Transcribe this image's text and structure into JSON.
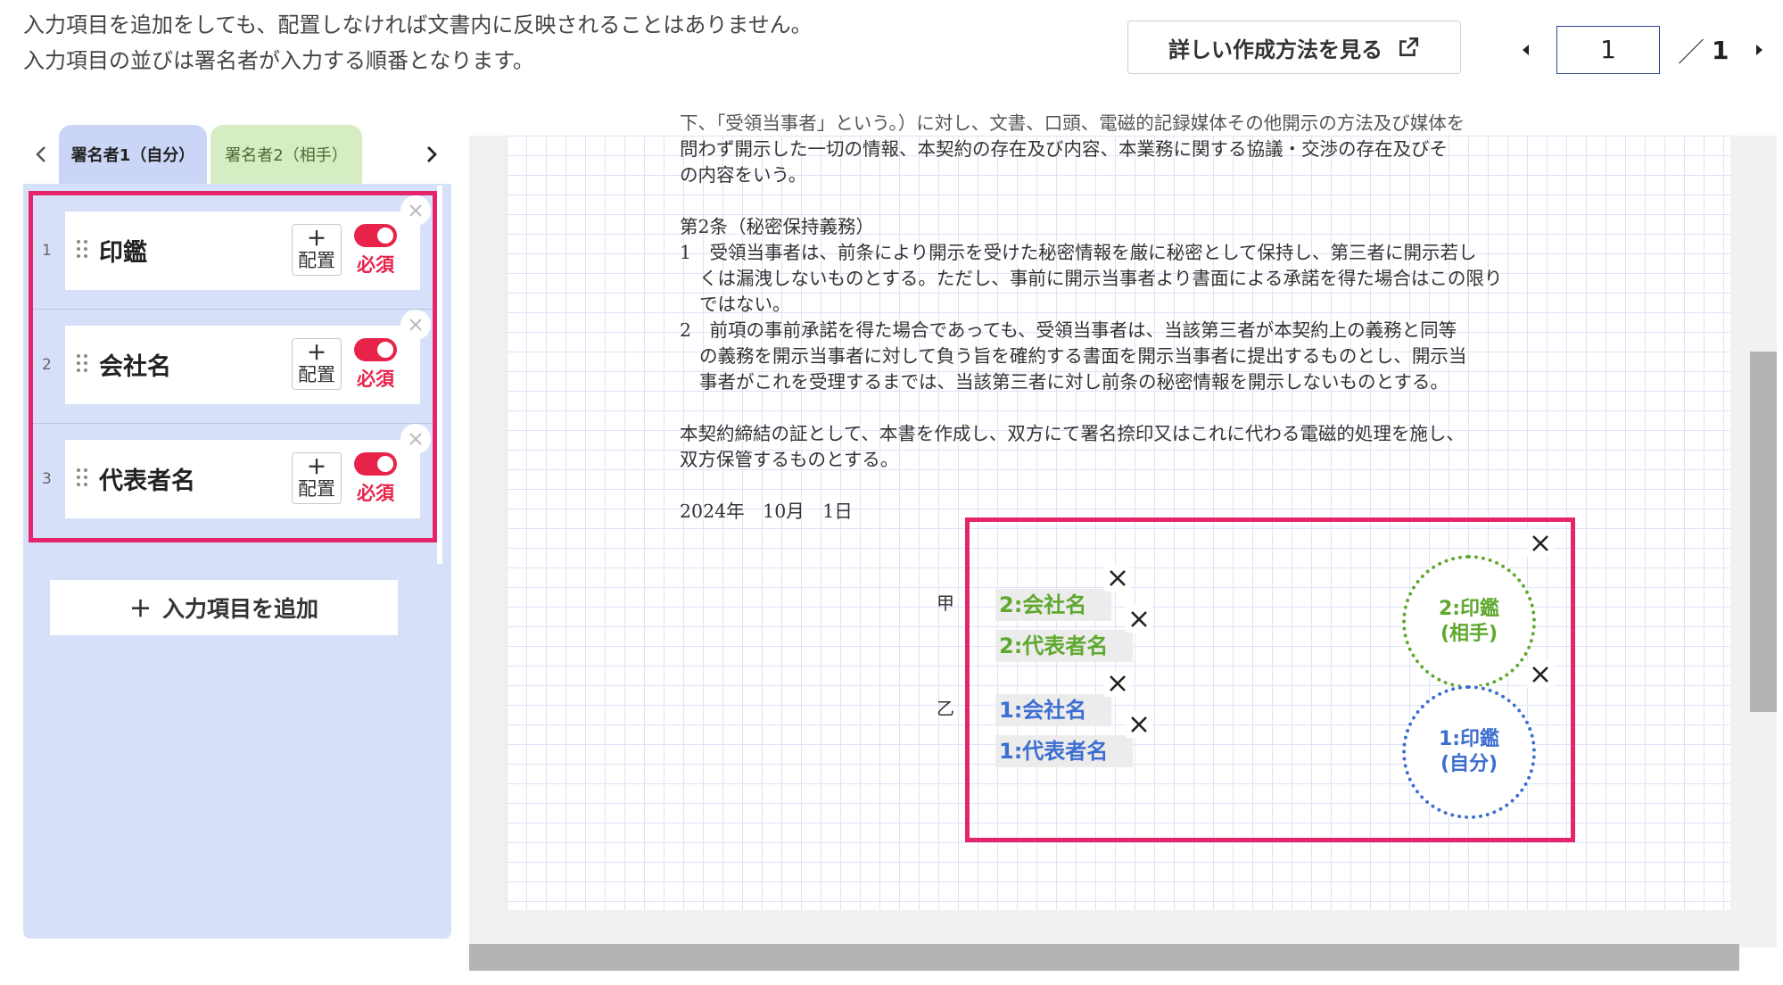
{
  "intro": {
    "line1": "入力項目を追加をしても、配置しなければ文書内に反映されることはありません。",
    "line2": "入力項目の並びは署名者が入力する順番となります。"
  },
  "howto_button": {
    "label": "詳しい作成方法を見る",
    "icon": "external-link-icon"
  },
  "pager": {
    "current": "1",
    "separator": "／",
    "total": "1"
  },
  "signer_tabs": [
    {
      "label": "署名者1（自分）",
      "selected": true,
      "color": "#cbd6f7"
    },
    {
      "label": "署名者2（相手）",
      "selected": false,
      "color": "#d6ecc2"
    }
  ],
  "fields": [
    {
      "num": "1",
      "label": "印鑑"
    },
    {
      "num": "2",
      "label": "会社名"
    },
    {
      "num": "3",
      "label": "代表者名"
    }
  ],
  "field_controls": {
    "place_plus": "＋",
    "place_label": "配置",
    "required_label": "必須"
  },
  "add_button": {
    "plus": "＋",
    "label": "入力項目を追加"
  },
  "document": {
    "lines": [
      "下、「受領当事者」という。）に対し、文書、口頭、電磁的記録媒体その他開示の方法及び媒体を",
      "問わず開示した一切の情報、本契約の存在及び内容、本業務に関する協議・交渉の存在及びそ",
      "の内容をいう。",
      "第2条（秘密保持義務）",
      "1　受領当事者は、前条により開示を受けた秘密情報を厳に秘密として保持し、第三者に開示若し",
      "くは漏洩しないものとする。ただし、事前に開示当事者より書面による承諾を得た場合はこの限り",
      "ではない。",
      "2　前項の事前承諾を得た場合であっても、受領当事者は、当該第三者が本契約上の義務と同等",
      "の義務を開示当事者に対して負う旨を確約する書面を開示当事者に提出するものとし、開示当",
      "事者がこれを受理するまでは、当該第三者に対し前条の秘密情報を開示しないものとする。",
      "本契約締結の証として、本書を作成し、双方にて署名捺印又はこれに代わる電磁的処理を施し、",
      "双方保管するものとする。",
      "2024年　10月　1日"
    ],
    "party_a": "甲",
    "party_b": "乙"
  },
  "placed_fields": {
    "signer2_company": "2:会社名",
    "signer2_rep": "2:代表者名",
    "signer1_company": "1:会社名",
    "signer1_rep": "1:代表者名",
    "signer2_seal_line1": "2:印鑑",
    "signer2_seal_line2": "(相手)",
    "signer1_seal_line1": "1:印鑑",
    "signer1_seal_line2": "(自分)"
  },
  "colors": {
    "highlight": "#e5246b",
    "required": "#e8234a",
    "signer1": "#3d6ed1",
    "signer2": "#5fa82e"
  }
}
